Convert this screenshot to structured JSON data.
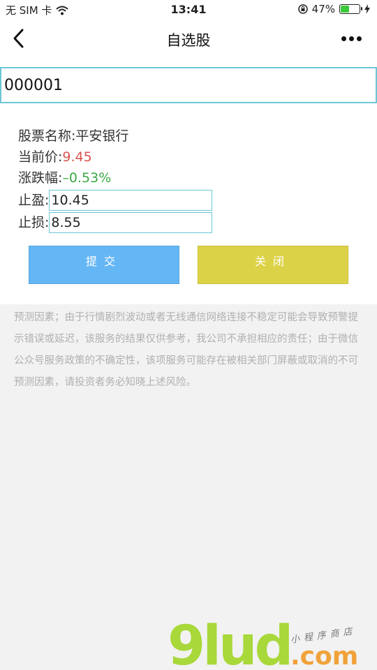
{
  "status_bar": {
    "carrier": "无 SIM 卡",
    "time": "13:41",
    "battery_percent": "47%",
    "battery_level": 0.47,
    "icons": [
      "wifi-icon",
      "lock-rotation-icon",
      "battery-icon",
      "charging-bolt-icon"
    ]
  },
  "nav": {
    "title": "自选股",
    "icons": [
      "back-chevron-icon",
      "more-dots-icon"
    ]
  },
  "search": {
    "value": "000001"
  },
  "stock": {
    "name_label": "股票名称:",
    "name": "平安银行",
    "price_label": "当前价:",
    "price": "9.45",
    "change_label": "涨跌幅:",
    "change": "–0.53%",
    "take_profit_label": "止盈:",
    "take_profit_value": "10.45",
    "stop_loss_label": "止损:",
    "stop_loss_value": "8.55"
  },
  "buttons": {
    "submit": "提交",
    "close": "关闭"
  },
  "disclaimer": "预测因素；由于行情剧烈波动或者无线通信网络连接不稳定可能会导致预警提示错误或延迟，该服务的结果仅供参考，我公司不承担相应的责任；由于微信公众号服务政策的不确定性，该项服务可能存在被相关部门屏蔽或取消的不可预测因素，请投资者务必知晓上述风险。",
  "watermark": {
    "logo_text": "9lud",
    "domain": ".com",
    "tagline": "小程序商店"
  },
  "colors": {
    "accent_border": "#6ec6d6",
    "price_red": "#d9534f",
    "change_green": "#3aa845",
    "submit_blue": "#65b6f4",
    "close_yellow": "#dcd247"
  }
}
